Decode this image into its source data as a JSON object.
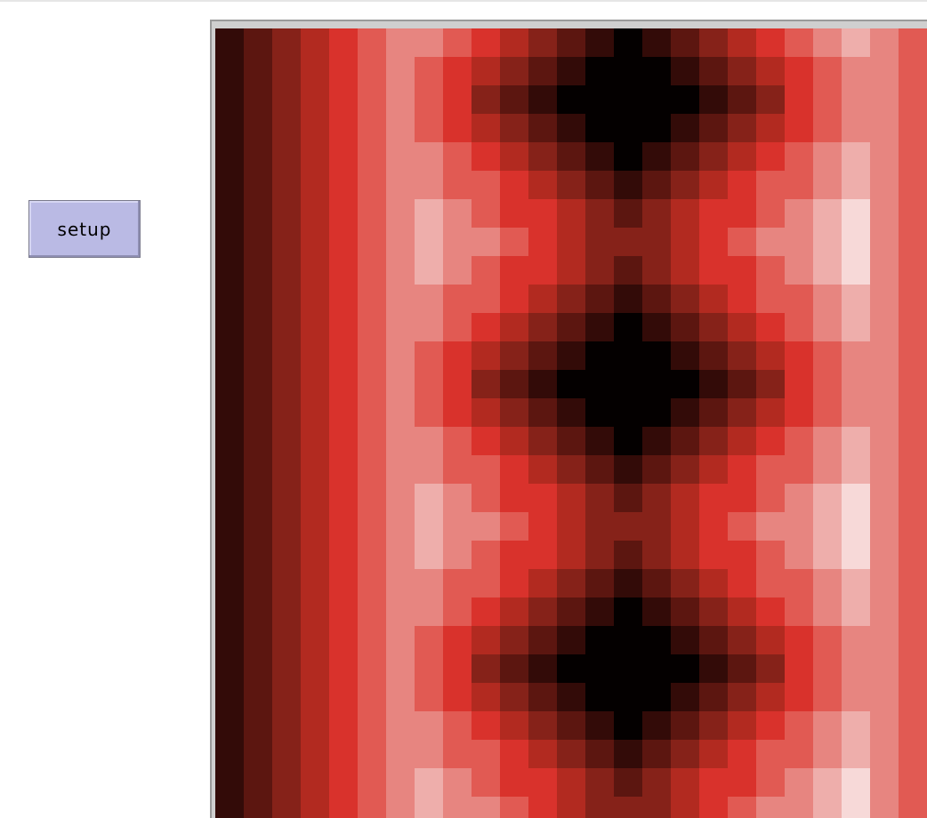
{
  "controls": {
    "setup_label": "setup"
  },
  "view": {
    "grid_columns": 25,
    "grid_rows": 28,
    "palette": [
      "#040000",
      "#330b08",
      "#5c1610",
      "#862219",
      "#b22a20",
      "#d9322c",
      "#e15a53",
      "#e78580",
      "#eeaeab",
      "#f7d9d8"
    ]
  }
}
